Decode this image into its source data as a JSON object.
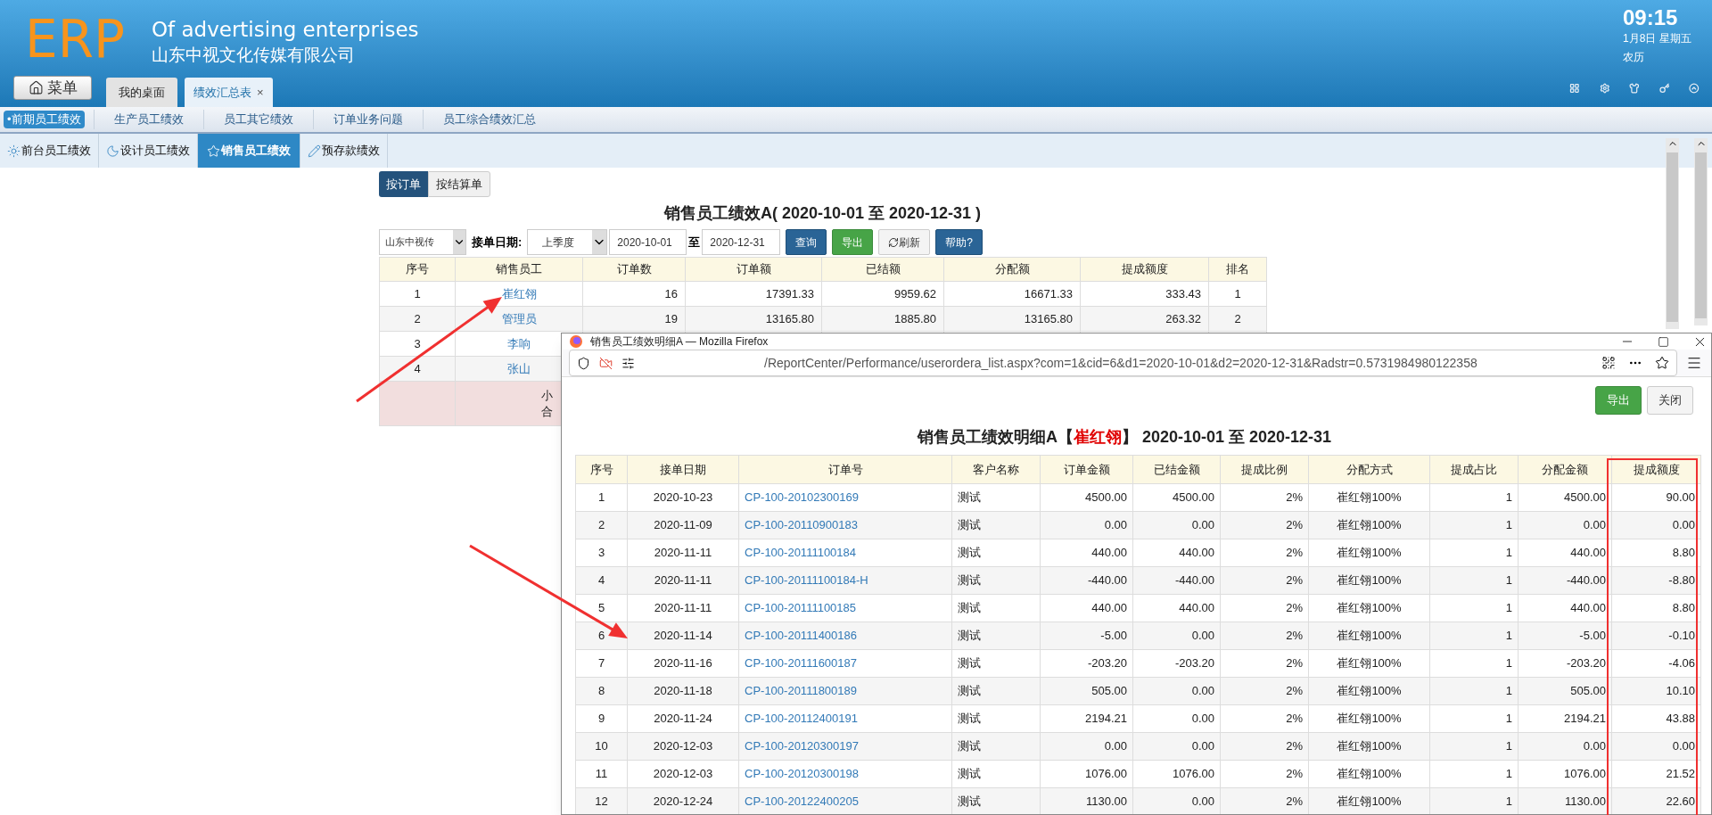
{
  "header": {
    "logo": "ERP",
    "tagline": "Of advertising enterprises",
    "company": "山东中视文化传媒有限公司",
    "menu_button": "菜单",
    "time": "09:15",
    "date": "1月8日 星期五",
    "lunar": "农历"
  },
  "tabs": [
    {
      "label": "我的桌面",
      "selected": false
    },
    {
      "label": "绩效汇总表",
      "selected": true,
      "close": "×"
    }
  ],
  "nav": [
    {
      "label": "•前期员工绩效",
      "selected": true
    },
    {
      "label": "生产员工绩效",
      "selected": false
    },
    {
      "label": "员工其它绩效",
      "selected": false
    },
    {
      "label": "订单业务问题",
      "selected": false
    },
    {
      "label": "员工综合绩效汇总",
      "selected": false
    }
  ],
  "sub_tabs": [
    {
      "label": "前台员工绩效",
      "selected": false,
      "kind": "sun"
    },
    {
      "label": "设计员工绩效",
      "selected": false,
      "kind": "moon"
    },
    {
      "label": "销售员工绩效",
      "selected": true,
      "kind": "star"
    },
    {
      "label": "预存款绩效",
      "selected": false,
      "kind": "pencil"
    }
  ],
  "view_toggle": [
    {
      "label": "按订单",
      "selected": true
    },
    {
      "label": "按结算单",
      "selected": false
    }
  ],
  "report": {
    "title": "销售员工绩效A( 2020-10-01 至 2020-12-31 )",
    "company_select": "山东中视传",
    "date_label": "接单日期:",
    "period_select": "上季度",
    "date_from": "2020-10-01",
    "to_label": "至",
    "date_to": "2020-12-31",
    "buttons": [
      {
        "label": "查询",
        "kind": "primary"
      },
      {
        "label": "导出",
        "kind": "success"
      },
      {
        "label": "刷新",
        "kind": "refresh"
      },
      {
        "label": "帮助?",
        "kind": "primary"
      }
    ],
    "table": {
      "columns": [
        "序号",
        "销售员工",
        "订单数",
        "订单额",
        "已结额",
        "分配额",
        "提成额度",
        "排名"
      ],
      "rows": [
        [
          "1",
          "崔红翎",
          "16",
          "17391.33",
          "9959.62",
          "16671.33",
          "333.43",
          "1"
        ],
        [
          "2",
          "管理员",
          "19",
          "13165.80",
          "1885.80",
          "13165.80",
          "263.32",
          "2"
        ],
        [
          "3",
          "李响"
        ],
        [
          "4",
          "张山"
        ]
      ],
      "summary": [
        "小",
        "合"
      ]
    }
  },
  "popup": {
    "title": "销售员工绩效明细A — Mozilla Firefox",
    "url": "/ReportCenter/Performance/userordera_list.aspx?com=1&cid=6&d1=2020-10-01&d2=2020-12-31&Radstr=0.5731984980122358",
    "buttons": [
      {
        "label": "导出",
        "kind": "success"
      },
      {
        "label": "关闭",
        "kind": "default"
      }
    ],
    "heading_prefix": "销售员工绩效明细A【",
    "heading_name": "崔红翎",
    "heading_suffix": "】 2020-10-01 至 2020-12-31",
    "table": {
      "columns": [
        "序号",
        "接单日期",
        "订单号",
        "客户名称",
        "订单金额",
        "已结金额",
        "提成比例",
        "分配方式",
        "提成占比",
        "分配金额",
        "提成额度"
      ],
      "rows": [
        [
          "1",
          "2020-10-23",
          "CP-100-20102300169",
          "测试",
          "4500.00",
          "4500.00",
          "2%",
          "崔红翎100%",
          "1",
          "4500.00",
          "90.00"
        ],
        [
          "2",
          "2020-11-09",
          "CP-100-20110900183",
          "测试",
          "0.00",
          "0.00",
          "2%",
          "崔红翎100%",
          "1",
          "0.00",
          "0.00"
        ],
        [
          "3",
          "2020-11-11",
          "CP-100-20111100184",
          "测试",
          "440.00",
          "440.00",
          "2%",
          "崔红翎100%",
          "1",
          "440.00",
          "8.80"
        ],
        [
          "4",
          "2020-11-11",
          "CP-100-20111100184-H",
          "测试",
          "-440.00",
          "-440.00",
          "2%",
          "崔红翎100%",
          "1",
          "-440.00",
          "-8.80"
        ],
        [
          "5",
          "2020-11-11",
          "CP-100-20111100185",
          "测试",
          "440.00",
          "440.00",
          "2%",
          "崔红翎100%",
          "1",
          "440.00",
          "8.80"
        ],
        [
          "6",
          "2020-11-14",
          "CP-100-20111400186",
          "测试",
          "-5.00",
          "0.00",
          "2%",
          "崔红翎100%",
          "1",
          "-5.00",
          "-0.10"
        ],
        [
          "7",
          "2020-11-16",
          "CP-100-20111600187",
          "测试",
          "-203.20",
          "-203.20",
          "2%",
          "崔红翎100%",
          "1",
          "-203.20",
          "-4.06"
        ],
        [
          "8",
          "2020-11-18",
          "CP-100-20111800189",
          "测试",
          "505.00",
          "0.00",
          "2%",
          "崔红翎100%",
          "1",
          "505.00",
          "10.10"
        ],
        [
          "9",
          "2020-11-24",
          "CP-100-20112400191",
          "测试",
          "2194.21",
          "0.00",
          "2%",
          "崔红翎100%",
          "1",
          "2194.21",
          "43.88"
        ],
        [
          "10",
          "2020-12-03",
          "CP-100-20120300197",
          "测试",
          "0.00",
          "0.00",
          "2%",
          "崔红翎100%",
          "1",
          "0.00",
          "0.00"
        ],
        [
          "11",
          "2020-12-03",
          "CP-100-20120300198",
          "测试",
          "1076.00",
          "1076.00",
          "2%",
          "崔红翎100%",
          "1",
          "1076.00",
          "21.52"
        ],
        [
          "12",
          "2020-12-24",
          "CP-100-20122400205",
          "测试",
          "1130.00",
          "0.00",
          "2%",
          "崔红翎100%",
          "1",
          "1130.00",
          "22.60"
        ]
      ]
    }
  }
}
